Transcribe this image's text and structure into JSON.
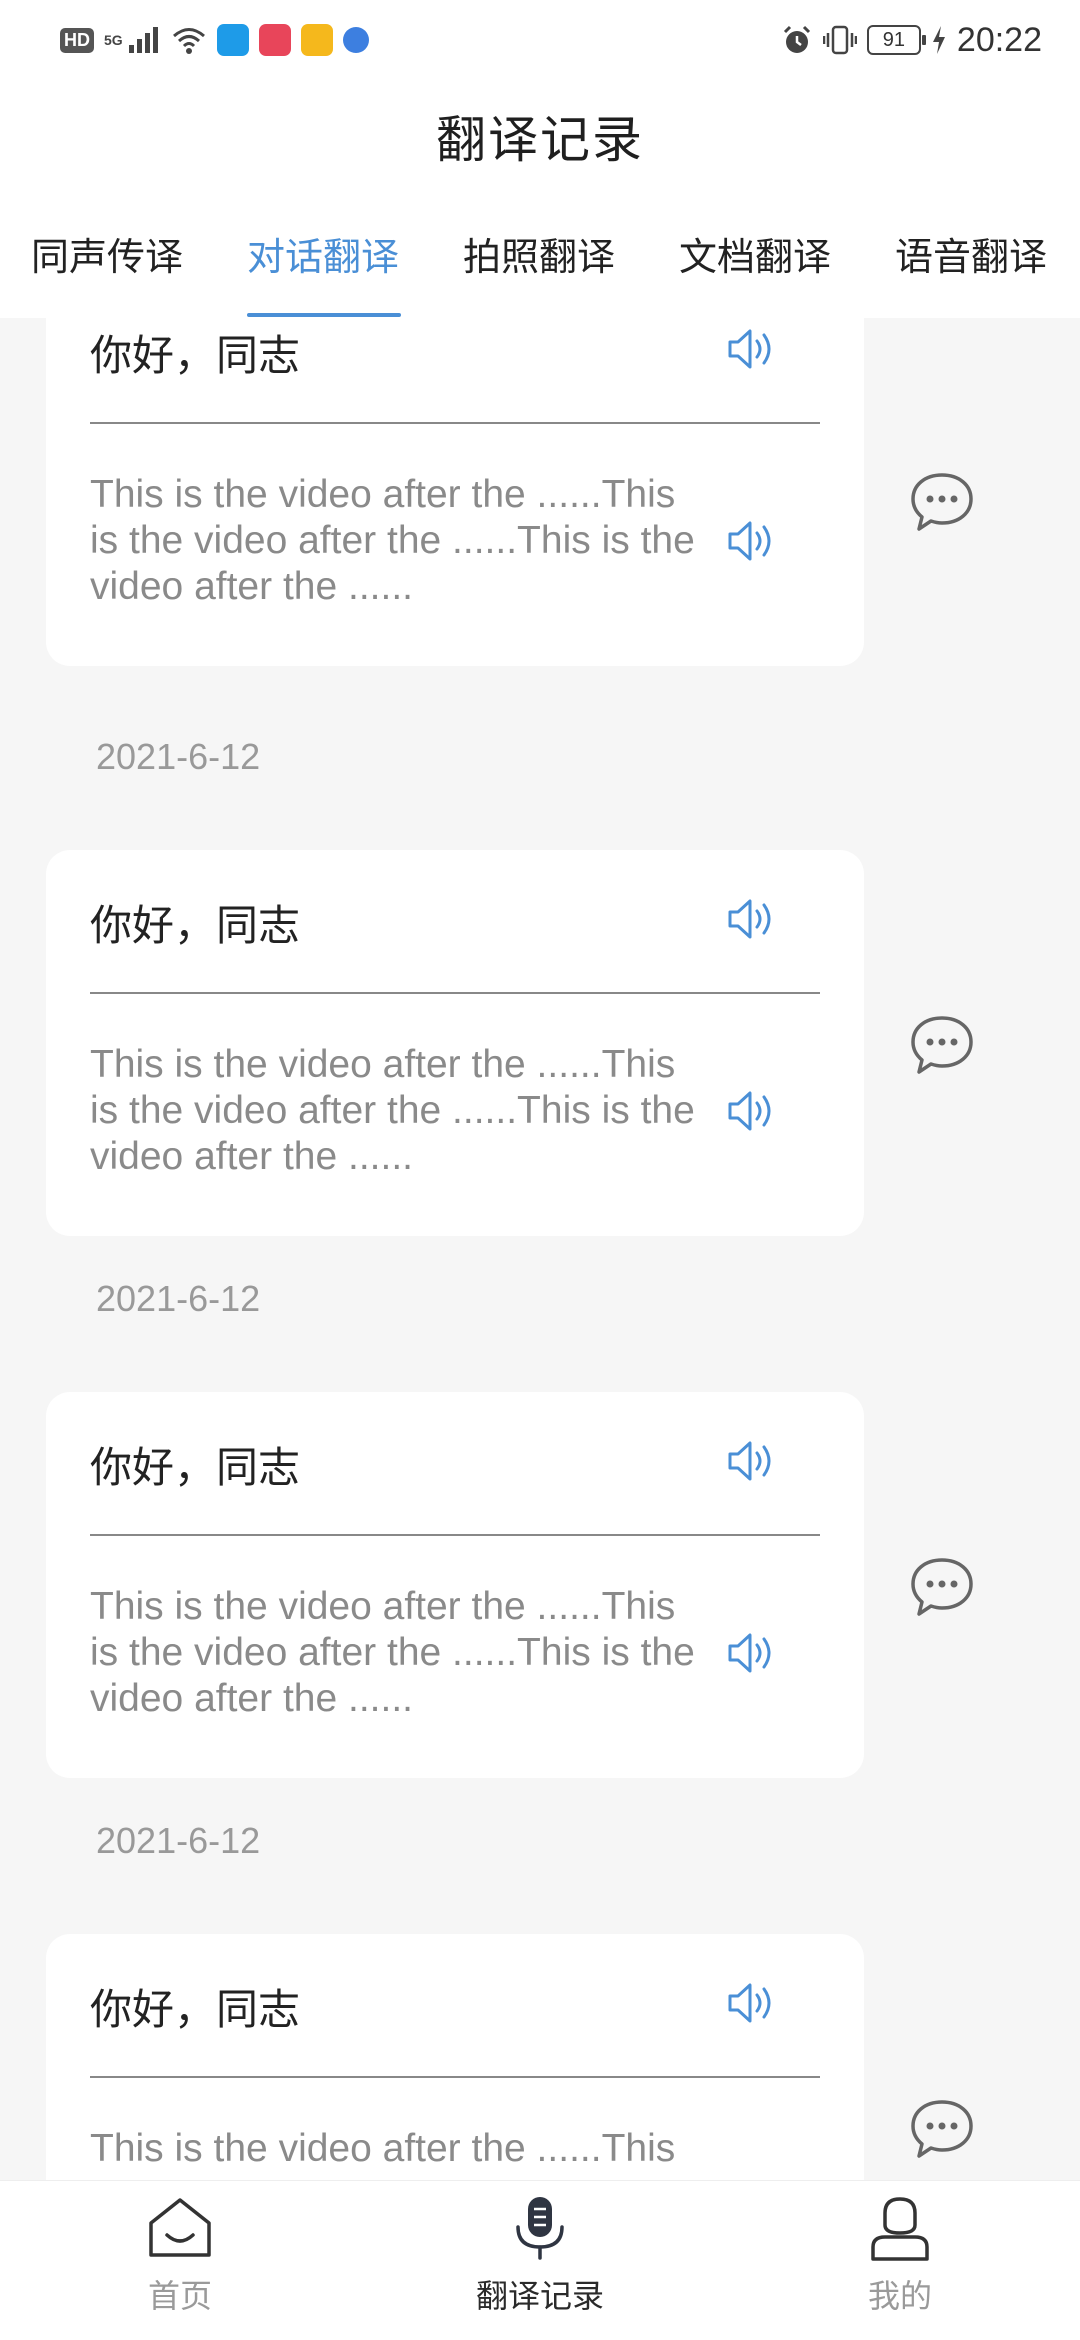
{
  "status_bar": {
    "badges": [
      "HD",
      "5G"
    ],
    "battery_level": "91",
    "time": "20:22",
    "icons": [
      "signal-icon",
      "wifi-icon",
      "browser-app-icon",
      "red-app-icon",
      "mail-app-icon",
      "globe-app-icon",
      "alarm-icon",
      "vibrate-icon",
      "battery-icon",
      "charging-icon"
    ]
  },
  "header": {
    "title": "翻译记录"
  },
  "tabs": [
    {
      "label": "同声传译",
      "active": false
    },
    {
      "label": "对话翻译",
      "active": true
    },
    {
      "label": "拍照翻译",
      "active": false
    },
    {
      "label": "文档翻译",
      "active": false
    },
    {
      "label": "语音翻译",
      "active": false
    }
  ],
  "records": [
    {
      "source_text": "你好，同志",
      "target_text": "This is the video after the ......This is the video after the ......This is the video after the ......",
      "date": "2021-6-12"
    },
    {
      "source_text": "你好，同志",
      "target_text": "This is the video after the ......This is the video after the ......This is the video after the ......",
      "date": "2021-6-12"
    },
    {
      "source_text": "你好，同志",
      "target_text": "This is the video after the ......This is the video after the ......This is the video after the ......",
      "date": "2021-6-12"
    },
    {
      "source_text": "你好，同志",
      "target_text": "This is the video after the ......This"
    }
  ],
  "bottom_nav": [
    {
      "label": "首页",
      "icon": "home-icon",
      "active": false
    },
    {
      "label": "翻译记录",
      "icon": "microphone-icon",
      "active": true
    },
    {
      "label": "我的",
      "icon": "user-icon",
      "active": false
    }
  ],
  "colors": {
    "accent": "#4a8fd6",
    "background": "#f6f6f6",
    "card": "#ffffff",
    "muted_text": "#8a8a8a"
  }
}
